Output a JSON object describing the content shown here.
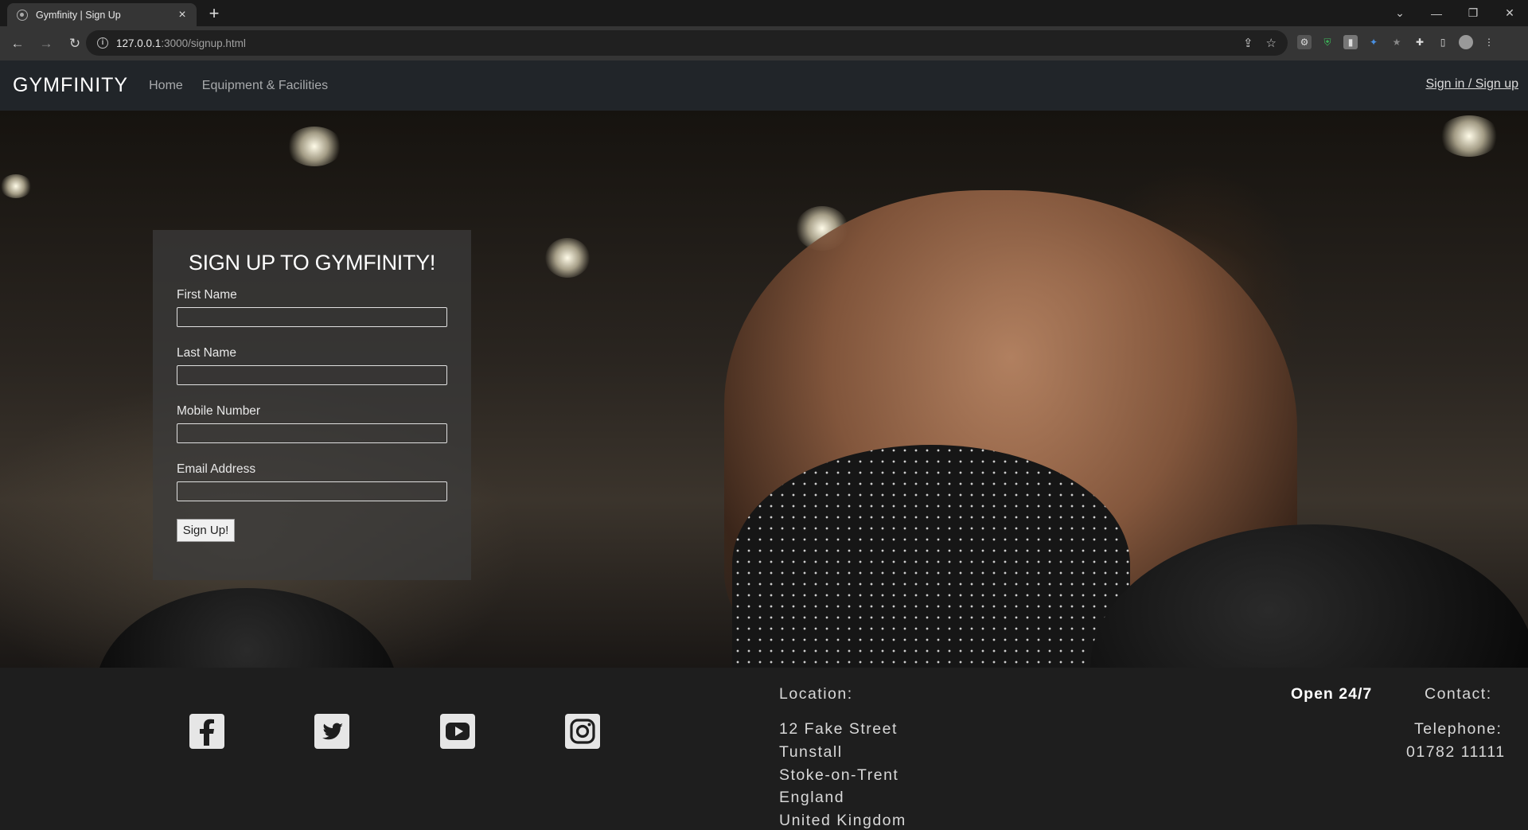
{
  "browser": {
    "tab_title": "Gymfinity | Sign Up",
    "url_host": "127.0.0.1",
    "url_path": ":3000/signup.html"
  },
  "navbar": {
    "brand": "GYMFINITY",
    "links": [
      "Home",
      "Equipment & Facilities"
    ],
    "signin": "Sign in / Sign up"
  },
  "signup": {
    "title": "SIGN UP TO GYMFINITY!",
    "fields": [
      {
        "label": "First Name",
        "value": ""
      },
      {
        "label": "Last Name",
        "value": ""
      },
      {
        "label": "Mobile Number",
        "value": ""
      },
      {
        "label": "Email Address",
        "value": ""
      }
    ],
    "button": "Sign Up!"
  },
  "footer": {
    "social": [
      "facebook-icon",
      "twitter-icon",
      "youtube-icon",
      "instagram-icon"
    ],
    "location_heading": "Location:",
    "address": [
      "12 Fake Street",
      "Tunstall",
      "Stoke-on-Trent",
      "England",
      "United Kingdom"
    ],
    "hours": "Open 24/7",
    "contact_heading": "Contact:",
    "telephone_label": "Telephone:",
    "telephone_number": "01782 11111"
  }
}
